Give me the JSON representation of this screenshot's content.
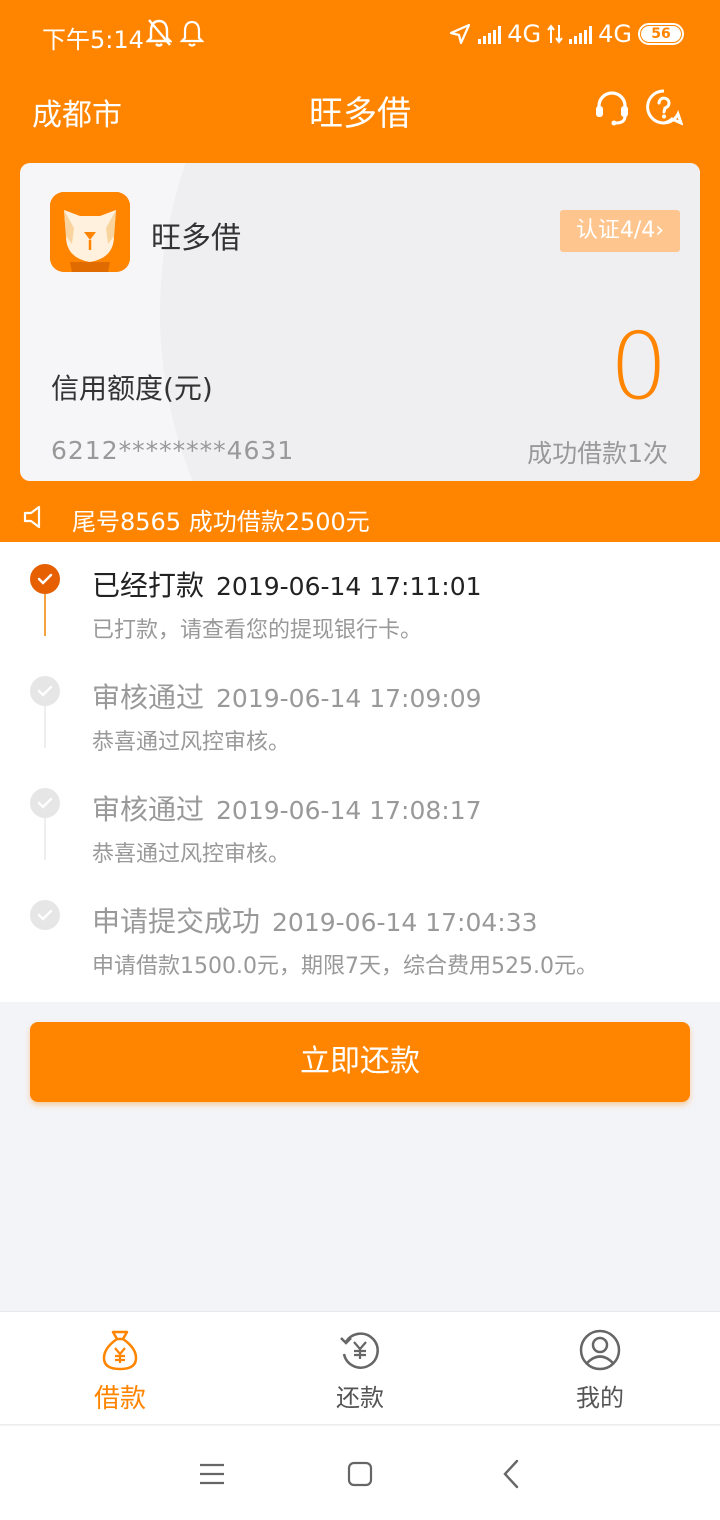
{
  "status_bar": {
    "time": "下午5:14",
    "network1": "4G",
    "network2": "4G",
    "battery": "56"
  },
  "nav": {
    "city": "成都市",
    "title": "旺多借"
  },
  "card": {
    "app_name": "旺多借",
    "verify_label": "认证4/4",
    "credit_label": "信用额度(元)",
    "credit_value": "0",
    "card_number": "6212********4631",
    "success_count": "成功借款1次"
  },
  "notice": {
    "text": "尾号8565 成功借款2500元"
  },
  "timeline": [
    {
      "title": "已经打款",
      "time": "2019-06-14 17:11:01",
      "desc": "已打款，请查看您的提现银行卡。"
    },
    {
      "title": "审核通过",
      "time": "2019-06-14 17:09:09",
      "desc": "恭喜通过风控审核。"
    },
    {
      "title": "审核通过",
      "time": "2019-06-14 17:08:17",
      "desc": "恭喜通过风控审核。"
    },
    {
      "title": "申请提交成功",
      "time": "2019-06-14 17:04:33",
      "desc": "申请借款1500.0元，期限7天，综合费用525.0元。"
    }
  ],
  "repay_button": "立即还款",
  "tabs": [
    {
      "label": "借款",
      "icon": "money-bag-icon"
    },
    {
      "label": "还款",
      "icon": "refresh-yuan-icon"
    },
    {
      "label": "我的",
      "icon": "user-icon"
    }
  ],
  "colors": {
    "brand": "#ff8500",
    "active_dot": "#e65f00"
  }
}
